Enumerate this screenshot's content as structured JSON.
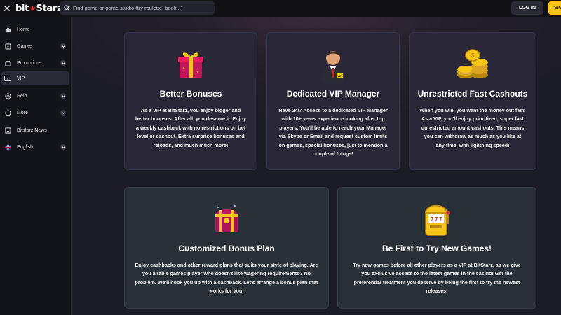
{
  "header": {
    "logo_left": "bit",
    "logo_right": "Starz",
    "search_placeholder": "Find game or game studio (try roulette, book...)",
    "login_label": "LOG IN",
    "signup_label": "SIG"
  },
  "sidebar": {
    "items": [
      {
        "label": "Home",
        "icon": "home-icon"
      },
      {
        "label": "Games",
        "icon": "games-icon",
        "expandable": true
      },
      {
        "label": "Promotions",
        "icon": "promotions-icon",
        "expandable": true
      },
      {
        "label": "VIP",
        "icon": "vip-icon",
        "active": true
      },
      {
        "label": "Help",
        "icon": "help-icon",
        "expandable": true
      },
      {
        "label": "More",
        "icon": "more-icon",
        "expandable": true
      },
      {
        "label": "Bitstarz News",
        "icon": "news-icon"
      },
      {
        "label": "English",
        "icon": "uk-flag-icon",
        "expandable": true
      }
    ]
  },
  "cards": [
    {
      "title": "Better Bonuses",
      "icon": "gift-box-icon",
      "text": "As a VIP at BitStarz, you enjoy bigger and better bonuses. After all, you deserve it. Enjoy a weekly cashback with no restrictions on bet level or cashout. Extra surprise bonuses and reloads, and much much more!"
    },
    {
      "title": "Dedicated VIP Manager",
      "icon": "vip-manager-icon",
      "text": "Have 24/7 Access to a dedicated VIP Manager with 10+ years experience looking after top players. You'll be able to reach your Manager via Skype or Email and request custom limits on games, special bonuses, just to mention a couple of things!"
    },
    {
      "title": "Unrestricted Fast Cashouts",
      "icon": "gold-coins-icon",
      "text": "When you win, you want the money out fast. As a VIP, you'll enjoy prioritized, super fast unrestricted amount cashouts. This means you can withdraw as much as you like at any time, with lightning speed!"
    },
    {
      "title": "Customized Bonus Plan",
      "icon": "treasure-chest-icon",
      "text": "Enjoy cashbacks and other reward plans that suits your style of playing. Are you a table games player who doesn't like wagering requirements? No problem. We'll hook you up with a cashback. Let's arrange a bonus plan that works for you!"
    },
    {
      "title": "Be First to Try New Games!",
      "icon": "slot-machine-icon",
      "text": "Try new games before all other players as a VIP at BitStarz, as we give you exclusive access to the latest games in the casino! Get the preferential treatment you deserve by being the first to try the newest releases!"
    }
  ],
  "colors": {
    "accent": "#f6c51a",
    "brand_red": "#e0312a",
    "card_bg": "#2a2838"
  }
}
